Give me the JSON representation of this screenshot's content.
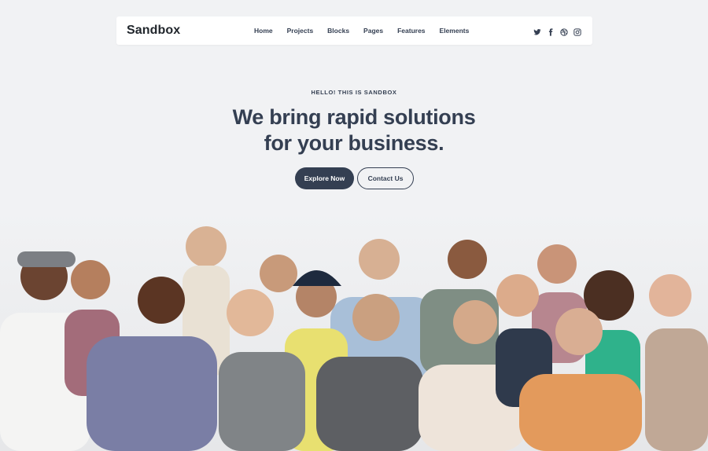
{
  "brand": {
    "name": "Sandbox"
  },
  "nav": {
    "items": [
      "Home",
      "Projects",
      "Blocks",
      "Pages",
      "Features",
      "Elements"
    ]
  },
  "social": [
    "twitter-icon",
    "facebook-icon",
    "dribbble-icon",
    "instagram-icon"
  ],
  "hero": {
    "eyebrow": "HELLO! THIS IS SANDBOX",
    "title_line1": "We bring rapid solutions",
    "title_line2": "for your business.",
    "primary_button": "Explore Now",
    "secondary_button": "Contact Us"
  },
  "colors": {
    "dark": "#343f52",
    "background": "#f1f2f4",
    "nav_bg": "#ffffff"
  }
}
